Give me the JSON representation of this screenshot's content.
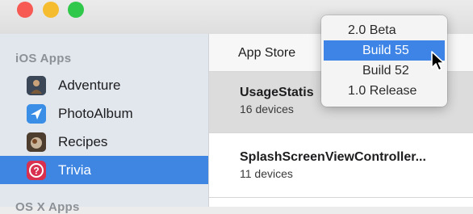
{
  "sidebar": {
    "section_ios": "iOS Apps",
    "section_osx_partial": "OS X Apps",
    "items": [
      {
        "label": "Adventure",
        "icon": "adventure-icon"
      },
      {
        "label": "PhotoAlbum",
        "icon": "photoalbum-icon"
      },
      {
        "label": "Recipes",
        "icon": "recipes-icon"
      },
      {
        "label": "Trivia",
        "icon": "trivia-icon",
        "selected": true
      }
    ]
  },
  "toolbar": {
    "tab_label": "App Store"
  },
  "list": {
    "rows": [
      {
        "title": "UsageStatis",
        "subtitle": "16 devices",
        "selected": true
      },
      {
        "title": "SplashScreenViewController...",
        "subtitle": "11 devices",
        "selected": false
      }
    ]
  },
  "version_menu": {
    "items": [
      "2.0 Beta",
      "Build 55",
      "Build 52",
      "1.0 Release"
    ],
    "highlighted": "Build 55"
  },
  "colors": {
    "accent": "#3f86e3",
    "sidebar_bg": "#e2e7ee",
    "selected_row": "#dcdcdc"
  }
}
